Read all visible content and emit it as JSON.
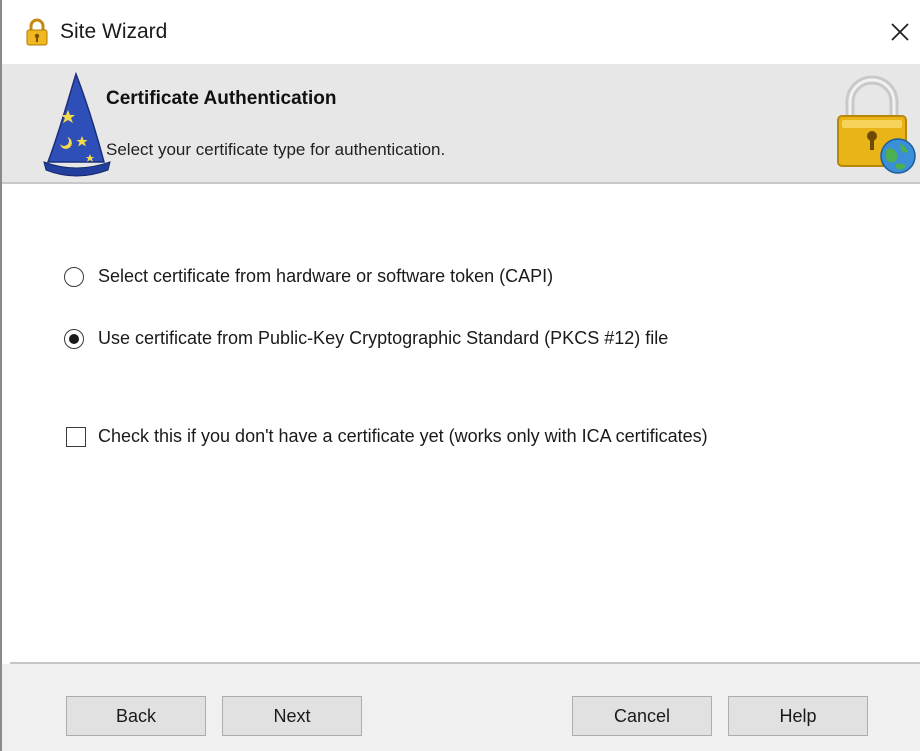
{
  "window": {
    "title": "Site Wizard",
    "close_glyph": "✕"
  },
  "header": {
    "title": "Certificate Authentication",
    "subtitle": "Select your certificate type for authentication."
  },
  "options": {
    "capi_label": "Select certificate from hardware or software token (CAPI)",
    "capi_selected": false,
    "pkcs_label": "Use certificate from Public-Key Cryptographic Standard (PKCS #12) file",
    "pkcs_selected": true,
    "no_cert_label": "Check this if you don't have a certificate yet (works only with ICA certificates)",
    "no_cert_checked": false
  },
  "buttons": {
    "back": "Back",
    "next": "Next",
    "cancel": "Cancel",
    "help": "Help"
  },
  "icons": {
    "title": "lock-icon",
    "header_left": "wizard-hat-icon",
    "header_right": "lock-globe-icon"
  },
  "colors": {
    "header_band": "#e7e7e7",
    "footer": "#f0f0f0",
    "button_face": "#e1e1e1",
    "lock_gold": "#e8b418"
  }
}
